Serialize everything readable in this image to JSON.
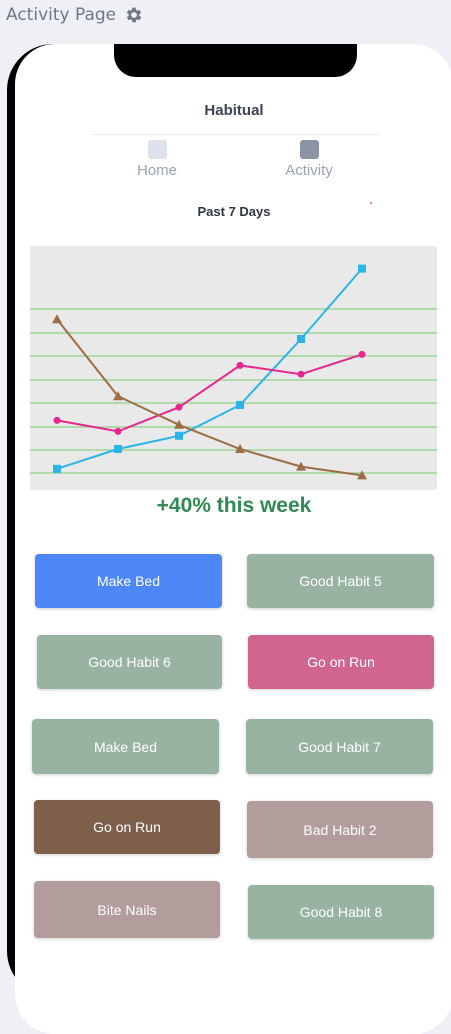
{
  "page": {
    "title": "Activity Page",
    "settings_icon": "gear-icon"
  },
  "app": {
    "title": "Habitual",
    "tabs": [
      {
        "label": "Home",
        "icon": "home-icon"
      },
      {
        "label": "Activity",
        "icon": "activity-icon"
      }
    ],
    "period": "Past 7 Days",
    "summary": "+40% this week"
  },
  "chart_data": {
    "type": "line",
    "x": [
      1,
      2,
      3,
      4,
      5,
      6
    ],
    "ylim": [
      0,
      10
    ],
    "grid": true,
    "series": [
      {
        "color": "#2ab4e8",
        "marker": "square",
        "values": [
          0.6,
          1.5,
          2.1,
          3.5,
          6.5,
          9.7
        ]
      },
      {
        "color": "#e6288a",
        "marker": "circle",
        "values": [
          2.8,
          2.3,
          3.4,
          5.3,
          4.9,
          5.8
        ]
      },
      {
        "color": "#9b6e45",
        "marker": "triangle",
        "values": [
          7.4,
          3.9,
          2.6,
          1.5,
          0.7,
          0.3
        ]
      }
    ]
  },
  "habits": [
    {
      "label": "Make Bed",
      "color": "#4c86f7"
    },
    {
      "label": "Good Habit 5",
      "color": "#98b3a1"
    },
    {
      "label": "Good Habit 6",
      "color": "#98b3a1"
    },
    {
      "label": "Go on Run",
      "color": "#d0668d"
    },
    {
      "label": "Make Bed",
      "color": "#98b3a1"
    },
    {
      "label": "Good Habit 7",
      "color": "#98b3a1"
    },
    {
      "label": "Go on Run",
      "color": "#7d5f4c"
    },
    {
      "label": "Bad Habit 2",
      "color": "#b39c9c"
    },
    {
      "label": "Bite Nails",
      "color": "#b39c9c"
    },
    {
      "label": "Good Habit 8",
      "color": "#98b3a1"
    }
  ]
}
